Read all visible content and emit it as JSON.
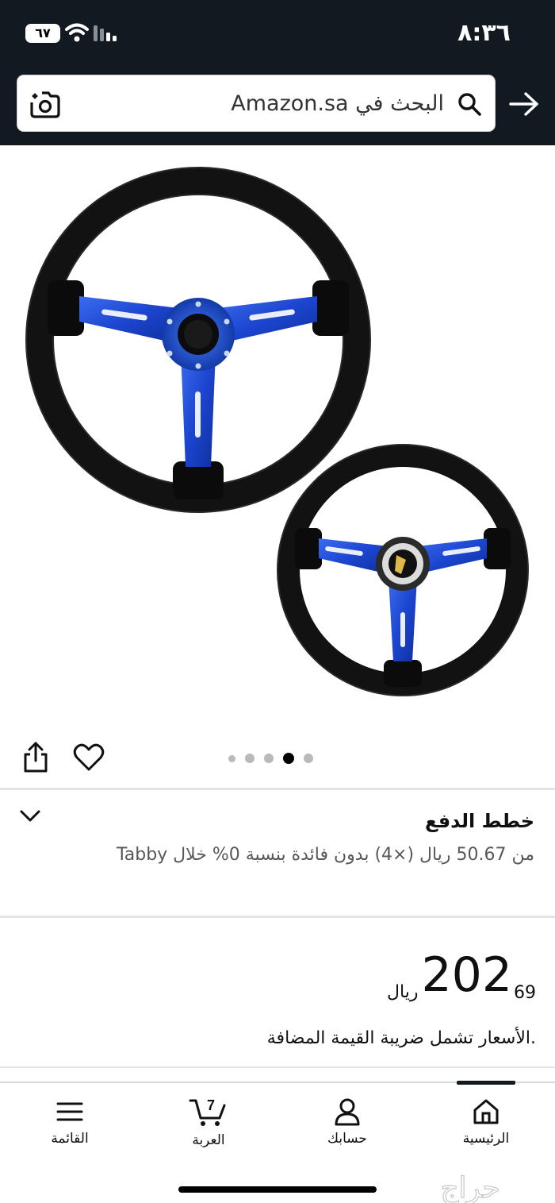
{
  "status_bar": {
    "time": "٨:٣٦",
    "battery": "٦٧"
  },
  "search": {
    "placeholder": "البحث في Amazon.sa"
  },
  "image_gallery": {
    "dot_count": 5,
    "active_dot": 3
  },
  "payment_plans": {
    "title": "خطط الدفع",
    "description": "من 50.67 ريال (×4) بدون فائدة بنسبة 0% خلال Tabby"
  },
  "price": {
    "whole": "202",
    "fraction": "69",
    "currency": "ريال",
    "vat_note": ".الأسعار تشمل ضريبة القيمة المضافة"
  },
  "bottom_nav": {
    "home": "الرئيسية",
    "account": "حسابك",
    "cart": "العربة",
    "cart_count": "7",
    "menu": "القائمة"
  },
  "watermark": "حراج",
  "colors": {
    "header_bg": "#131921",
    "wheel_blue": "#1f4fd8",
    "wheel_black": "#111111",
    "divider": "#e3e6e6"
  }
}
